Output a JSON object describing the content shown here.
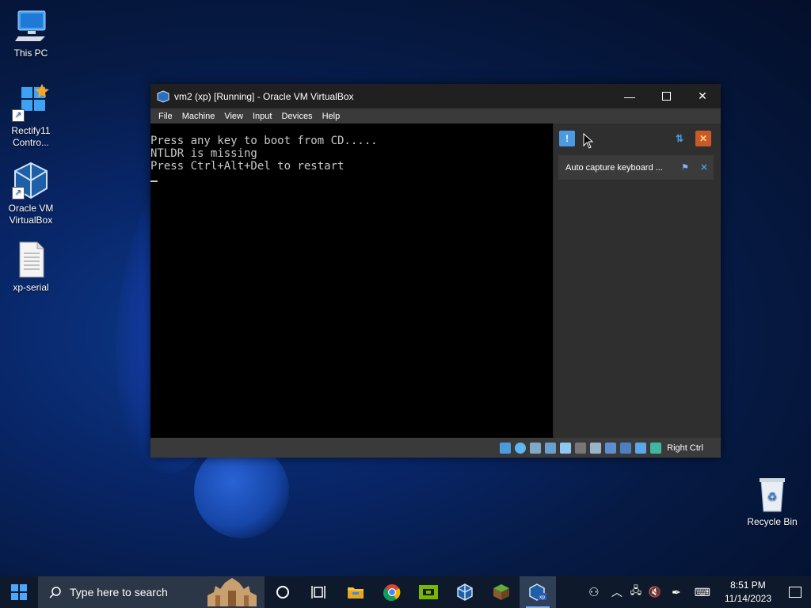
{
  "desktop": {
    "icons": [
      {
        "label": "This PC",
        "icon": "computer-icon"
      },
      {
        "label": "Rectify11 Contro...",
        "icon": "control-panel-icon"
      },
      {
        "label": "Oracle VM VirtualBox",
        "icon": "virtualbox-icon"
      },
      {
        "label": "xp-serial",
        "icon": "text-file-icon"
      },
      {
        "label": "Recycle Bin",
        "icon": "recycle-bin-icon"
      }
    ]
  },
  "window": {
    "title": "vm2 (xp) [Running] - Oracle VM VirtualBox",
    "menu": [
      "File",
      "Machine",
      "View",
      "Input",
      "Devices",
      "Help"
    ],
    "console_lines": [
      "Press any key to boot from CD.....",
      "NTLDR is missing",
      "Press Ctrl+Alt+Del to restart"
    ],
    "notification": "Auto capture keyboard ...",
    "host_key": "Right Ctrl"
  },
  "taskbar": {
    "search_placeholder": "Type here to search",
    "time": "8:51 PM",
    "date": "11/14/2023",
    "apps": [
      "cortana-icon",
      "task-view-icon",
      "file-explorer-icon",
      "chrome-icon",
      "nvidia-icon",
      "virtualbox-icon",
      "minecraft-icon",
      "vm-xp-icon"
    ]
  },
  "colors": {
    "accent": "#7fb4ff",
    "console_text": "#c8c8c8",
    "window_bg": "#2b2b2b"
  }
}
